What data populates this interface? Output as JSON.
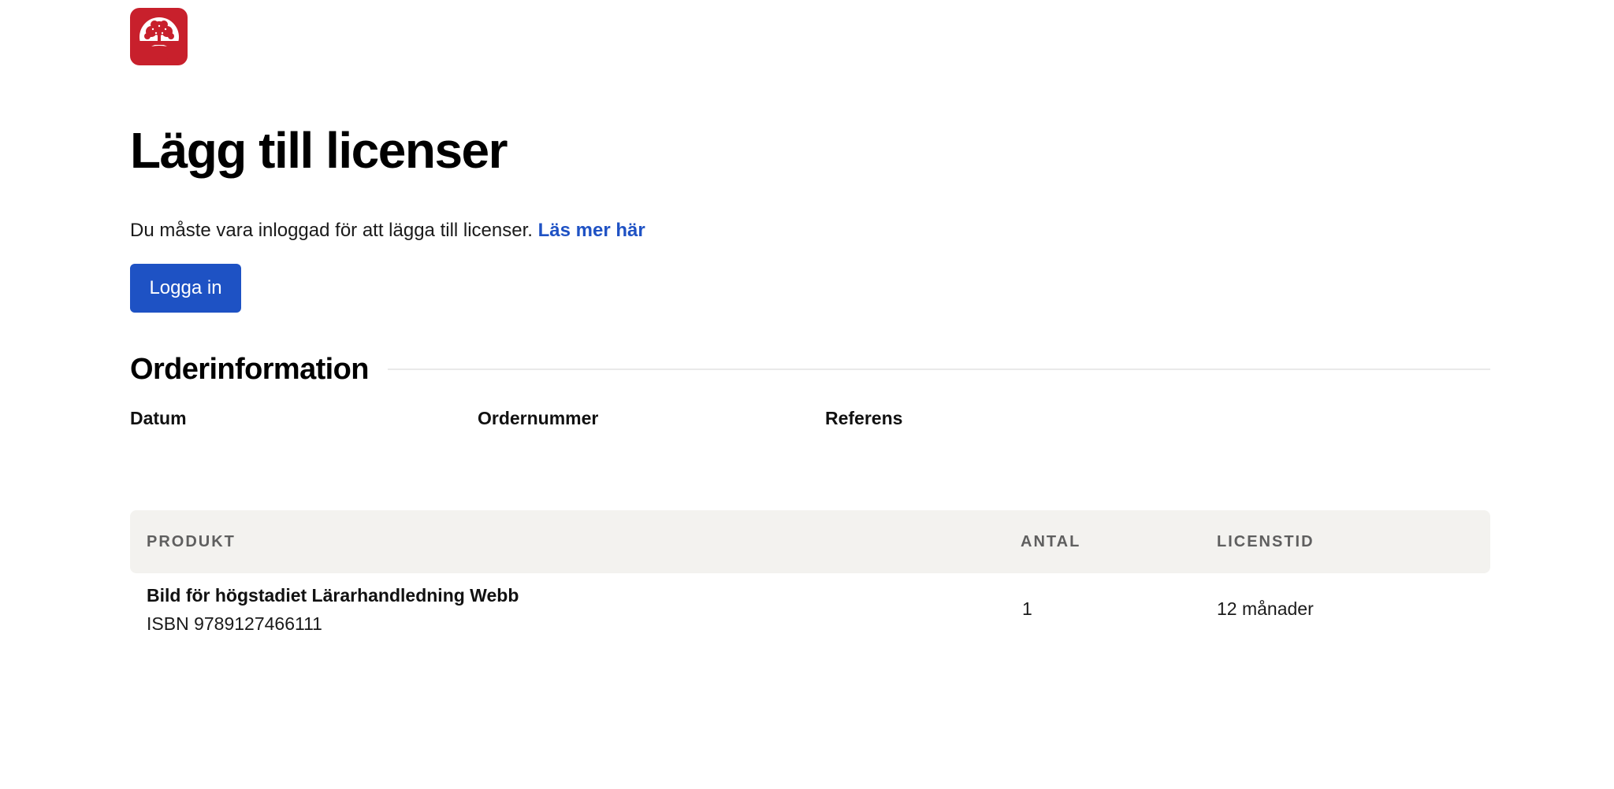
{
  "brand": {
    "logo_icon": "tree-logo-icon",
    "color": "#c8202c"
  },
  "page": {
    "title": "Lägg till licenser",
    "intro_text": "Du måste vara inloggad för att lägga till licenser.",
    "intro_link": "Läs mer här",
    "login_button": "Logga in",
    "link_color": "#1f52c4",
    "button_color": "#1e52c4"
  },
  "order": {
    "section_title": "Orderinformation",
    "labels": {
      "date": "Datum",
      "order_number": "Ordernummer",
      "reference": "Referens"
    }
  },
  "table": {
    "headers": {
      "product": "PRODUKT",
      "quantity": "ANTAL",
      "license_period": "LICENSTID"
    },
    "rows": [
      {
        "product_name": "Bild för högstadiet Lärarhandledning Webb",
        "isbn": "ISBN 9789127466111",
        "quantity": "1",
        "license_period": "12 månader"
      }
    ]
  }
}
